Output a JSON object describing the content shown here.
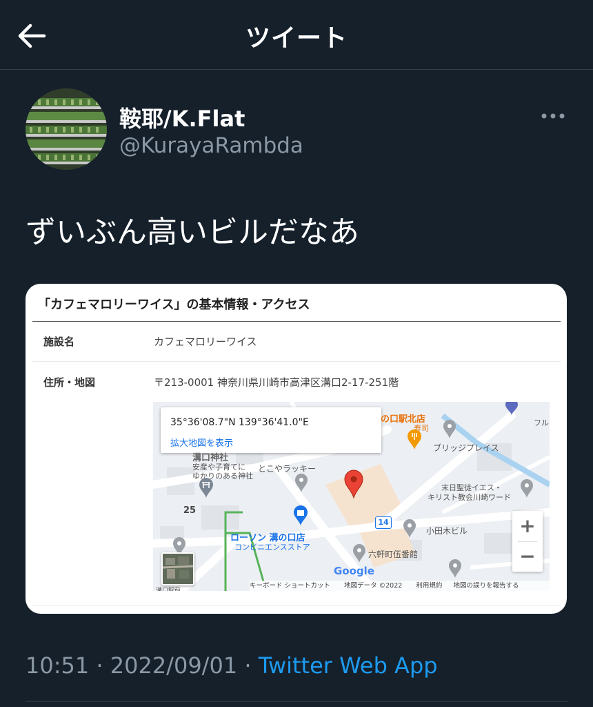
{
  "header": {
    "title": "ツイート",
    "back_icon": "arrow-left-icon"
  },
  "tweet": {
    "author": {
      "display_name": "鞍耶/K.Flat",
      "handle": "@KurayaRambda"
    },
    "text": "ずいぶん高いビルだなあ",
    "timestamp": "10:51 · 2022/09/01 · ",
    "source": "Twitter Web App"
  },
  "card": {
    "title": "「カフェマロリーワイス」の基本情報・アクセス",
    "rows": [
      {
        "label": "施設名",
        "value": "カフェマロリーワイス"
      },
      {
        "label": "住所・地図",
        "value": "〒213-0001 神奈川県川崎市高津区溝口2-17-251階"
      }
    ],
    "map": {
      "coords": "35°36'08.7\"N 139°36'41.0\"E",
      "link": "拡大地図を表示",
      "labels": {
        "shrine_title": "溝口神社",
        "shrine_desc1": "安産や子育てに",
        "shrine_desc2": "ゆかりのある神社",
        "tokoya": "とこやラッキー",
        "sushi_name": "の口駅北店",
        "sushi_type": "寿司",
        "bridge": "ブリッジプレイス",
        "church1": "末日聖徒イエス・",
        "church2": "キリスト教会川崎ワード",
        "odaki": "小田木ビル",
        "police": "六軒町伍番館",
        "lawson": "ローソン 溝の口店",
        "lawson_type": "コンビニエンスストア",
        "route": "14",
        "num25": "25",
        "full": "フル",
        "station": "溝口駅前"
      },
      "zoom_in": "+",
      "zoom_out": "−",
      "google": "Google",
      "attribution": {
        "shortcuts": "キーボード ショートカット",
        "data": "地図データ ©2022",
        "terms": "利用規約",
        "report": "地図の誤りを報告する"
      }
    }
  },
  "colors": {
    "background": "#15202b",
    "text": "#ffffff",
    "muted": "#8b98a5",
    "link": "#1d9bf0",
    "separator": "#38444d",
    "pin": "#ea4335"
  }
}
